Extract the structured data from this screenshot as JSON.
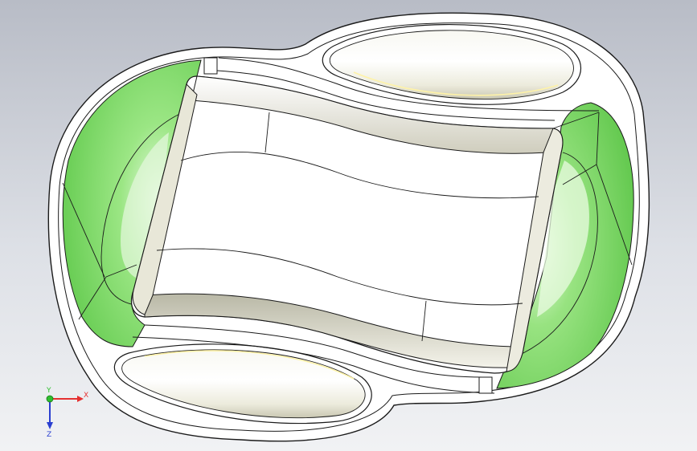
{
  "viewport": {
    "background_top": "#b8bcc6",
    "background_bottom": "#eef0f3",
    "colors": {
      "cavity_green": "#7fdc6a",
      "cavity_green_dark": "#4caf3a",
      "body_white": "#ffffff",
      "inner_shade": "#d9d8c8",
      "edge_line": "#1a1a1a",
      "pad_highlight": "#fffbe0"
    }
  },
  "triad": {
    "x_label": "X",
    "y_label": "Y",
    "z_label": "Z",
    "x_color": "#e53030",
    "y_color": "#2fbf2f",
    "z_color": "#2a3fd0"
  }
}
